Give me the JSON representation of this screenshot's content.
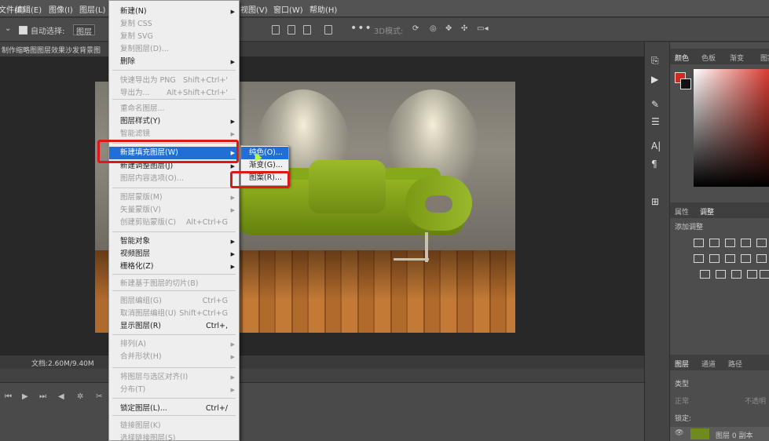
{
  "menubar": {
    "items": [
      "文件(F)",
      "编辑(E)",
      "图像(I)",
      "图层(L)",
      "视图(V)",
      "窗口(W)",
      "帮助(H)"
    ]
  },
  "options": {
    "auto_select_label": "自动选择:",
    "auto_select_value": "图层"
  },
  "document": {
    "tab_title": "制作缩略图图层效果沙发背景图"
  },
  "status": {
    "doc_size": "文档:2.60M/9.40M"
  },
  "context_menu": {
    "items": [
      {
        "label": "新建(N)",
        "shortcut": "",
        "arrow": true,
        "disabled": false
      },
      {
        "label": "复制 CSS",
        "shortcut": "",
        "arrow": false,
        "disabled": true
      },
      {
        "label": "复制 SVG",
        "shortcut": "",
        "arrow": false,
        "disabled": true
      },
      {
        "label": "复制图层(D)...",
        "shortcut": "",
        "arrow": false,
        "disabled": true
      },
      {
        "label": "删除",
        "shortcut": "",
        "arrow": true,
        "disabled": false
      },
      {
        "label": "快速导出为 PNG",
        "shortcut": "Shift+Ctrl+'",
        "arrow": false,
        "disabled": true
      },
      {
        "label": "导出为...",
        "shortcut": "Alt+Shift+Ctrl+'",
        "arrow": false,
        "disabled": true
      },
      {
        "label": "重命名图层...",
        "shortcut": "",
        "arrow": false,
        "disabled": true
      },
      {
        "label": "图层样式(Y)",
        "shortcut": "",
        "arrow": true,
        "disabled": false
      },
      {
        "label": "智能滤镜",
        "shortcut": "",
        "arrow": true,
        "disabled": true
      },
      {
        "label": "新建填充图层(W)",
        "shortcut": "",
        "arrow": true,
        "disabled": false,
        "selected": true
      },
      {
        "label": "新建调整图层(J)",
        "shortcut": "",
        "arrow": true,
        "disabled": false
      },
      {
        "label": "图层内容选项(O)...",
        "shortcut": "",
        "arrow": false,
        "disabled": true
      },
      {
        "label": "图层蒙版(M)",
        "shortcut": "",
        "arrow": true,
        "disabled": true
      },
      {
        "label": "矢量蒙版(V)",
        "shortcut": "",
        "arrow": true,
        "disabled": true
      },
      {
        "label": "创建剪贴蒙版(C)",
        "shortcut": "Alt+Ctrl+G",
        "arrow": false,
        "disabled": true
      },
      {
        "label": "智能对象",
        "shortcut": "",
        "arrow": true,
        "disabled": false
      },
      {
        "label": "视频图层",
        "shortcut": "",
        "arrow": true,
        "disabled": false
      },
      {
        "label": "栅格化(Z)",
        "shortcut": "",
        "arrow": true,
        "disabled": false
      },
      {
        "label": "新建基于图层的切片(B)",
        "shortcut": "",
        "arrow": false,
        "disabled": true
      },
      {
        "label": "图层编组(G)",
        "shortcut": "Ctrl+G",
        "arrow": false,
        "disabled": true
      },
      {
        "label": "取消图层编组(U)",
        "shortcut": "Shift+Ctrl+G",
        "arrow": false,
        "disabled": true
      },
      {
        "label": "显示图层(R)",
        "shortcut": "Ctrl+,",
        "arrow": false,
        "disabled": false
      },
      {
        "label": "排列(A)",
        "shortcut": "",
        "arrow": true,
        "disabled": true
      },
      {
        "label": "合并形状(H)",
        "shortcut": "",
        "arrow": true,
        "disabled": true
      },
      {
        "label": "将图层与选区对齐(I)",
        "shortcut": "",
        "arrow": true,
        "disabled": true
      },
      {
        "label": "分布(T)",
        "shortcut": "",
        "arrow": true,
        "disabled": true
      },
      {
        "label": "锁定图层(L)...",
        "shortcut": "Ctrl+/",
        "arrow": false,
        "disabled": false
      },
      {
        "label": "链接图层(K)",
        "shortcut": "",
        "arrow": false,
        "disabled": true
      },
      {
        "label": "选择链接图层(S)",
        "shortcut": "",
        "arrow": false,
        "disabled": true
      }
    ]
  },
  "submenu": {
    "items": [
      {
        "label": "纯色(O)...",
        "selected": true
      },
      {
        "label": "渐变(G)...",
        "selected": false
      },
      {
        "label": "图案(R)...",
        "selected": false
      }
    ]
  },
  "panels": {
    "color_tabs": [
      "颜色",
      "色板",
      "渐变",
      "图案"
    ],
    "adjust_tabs": [
      "属性",
      "调整"
    ],
    "adjust_title": "添加调整",
    "layer_tabs": [
      "图层",
      "通道",
      "路径"
    ],
    "layer_filter": "类型",
    "layer_mode": "正常",
    "layer_opacity": "不透明",
    "lock_label": "锁定:",
    "layer_name": "图层 0 副本"
  },
  "colors": {
    "highlight": "#e11717",
    "selection": "#1f6fd6",
    "foreground_swatch": "#d12b20",
    "sofa": "#7a9a16"
  }
}
